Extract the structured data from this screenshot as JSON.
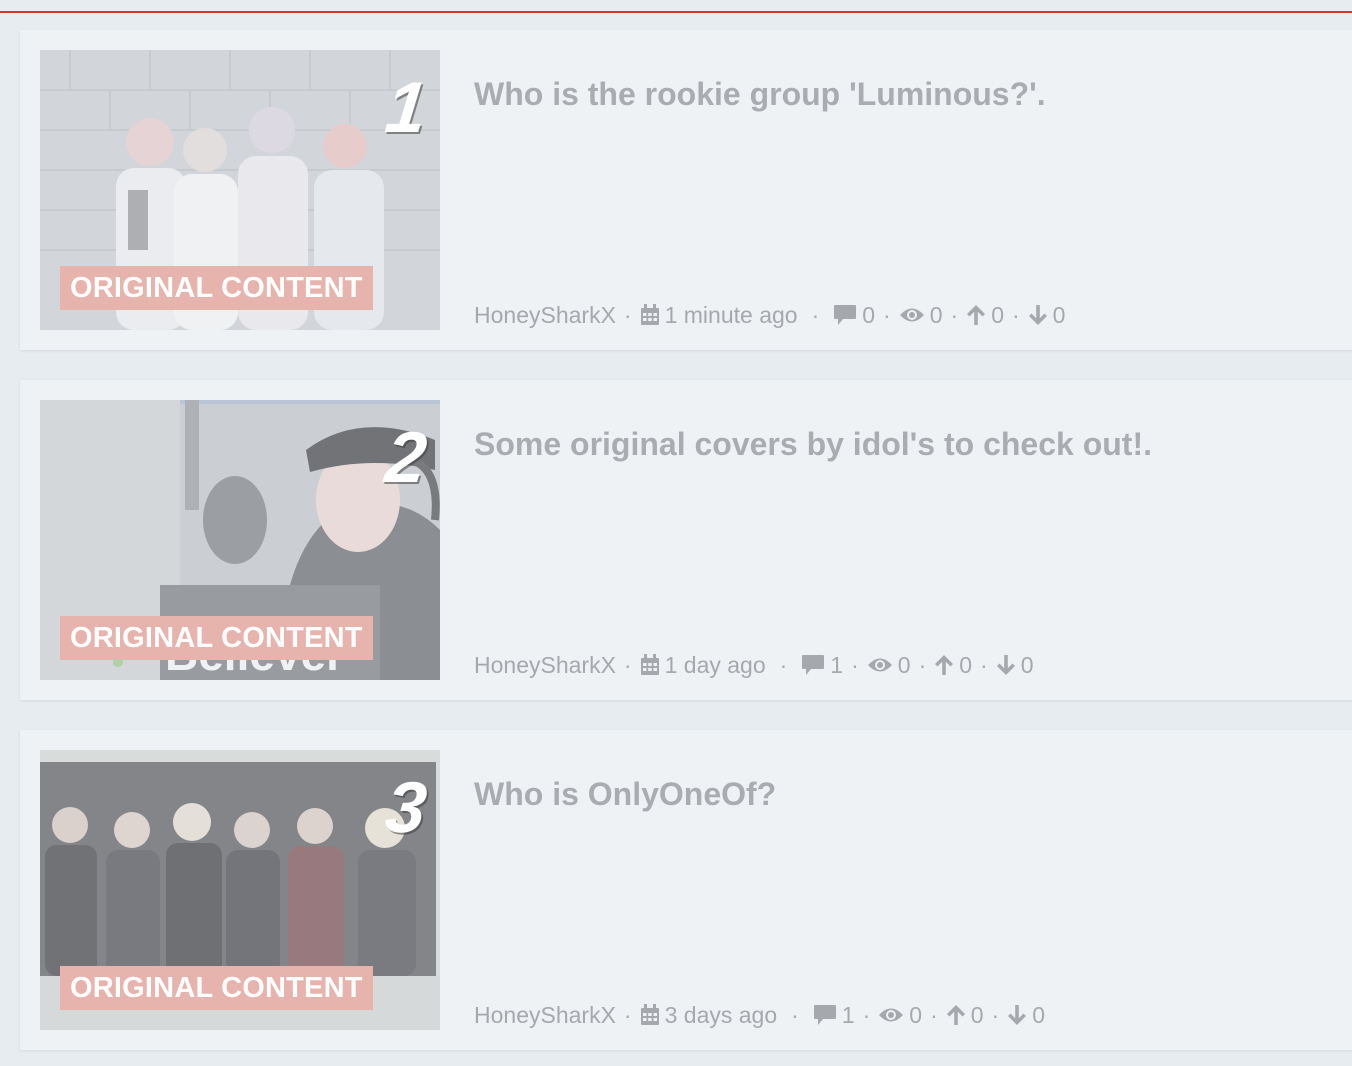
{
  "posts": [
    {
      "rank": "1",
      "badge": "ORIGINAL CONTENT",
      "title": "Who is the rookie group 'Luminous?'.",
      "author": "HoneySharkX",
      "date": "1 minute ago",
      "comments": "0",
      "views": "0",
      "upvotes": "0",
      "downvotes": "0"
    },
    {
      "rank": "2",
      "badge": "ORIGINAL CONTENT",
      "title": "Some original covers by idol's to check out!.",
      "author": "HoneySharkX",
      "date": "1 day ago",
      "comments": "1",
      "views": "0",
      "upvotes": "0",
      "downvotes": "0"
    },
    {
      "rank": "3",
      "badge": "ORIGINAL CONTENT",
      "title": "Who is OnlyOneOf?",
      "author": "HoneySharkX",
      "date": "3 days ago",
      "comments": "1",
      "views": "0",
      "upvotes": "0",
      "downvotes": "0"
    }
  ],
  "icons": {
    "date": "calendar-icon",
    "comments": "comment-icon",
    "views": "eye-icon",
    "upvotes": "arrow-up-icon",
    "downvotes": "arrow-down-icon"
  },
  "colors": {
    "accent_rule": "#d9342b",
    "badge_bg": "#e6b3ad"
  }
}
